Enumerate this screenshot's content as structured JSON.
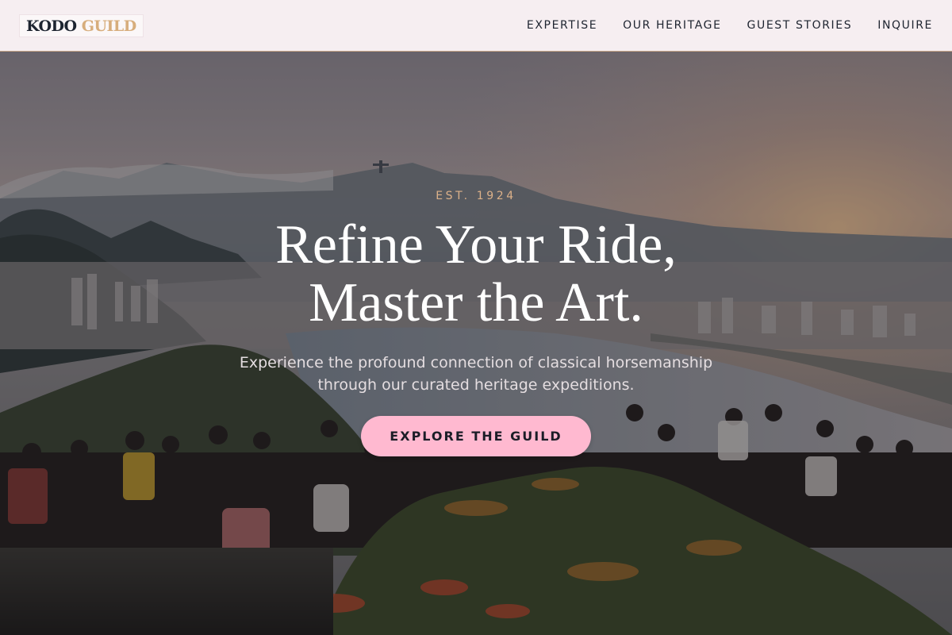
{
  "brand": {
    "name_primary": "KODO",
    "name_accent": "GUILD"
  },
  "nav": {
    "items": [
      {
        "label": "EXPERTISE"
      },
      {
        "label": "OUR HERITAGE"
      },
      {
        "label": "GUEST STORIES"
      },
      {
        "label": "INQUIRE"
      }
    ]
  },
  "hero": {
    "eyebrow": "EST. 1924",
    "headline_line1": "Refine Your Ride,",
    "headline_line2": "Master the Art.",
    "subtitle_line1": "Experience the profound connection of classical horsemanship",
    "subtitle_line2": "through our curated heritage expeditions.",
    "cta_label": "EXPLORE THE GUILD"
  },
  "colors": {
    "nav_background": "#f6eef1",
    "brand_dark": "#1d2430",
    "brand_gold": "#d7ad7c",
    "cta_pink": "#ffb9d0",
    "eyebrow_gold": "#dcb189"
  }
}
